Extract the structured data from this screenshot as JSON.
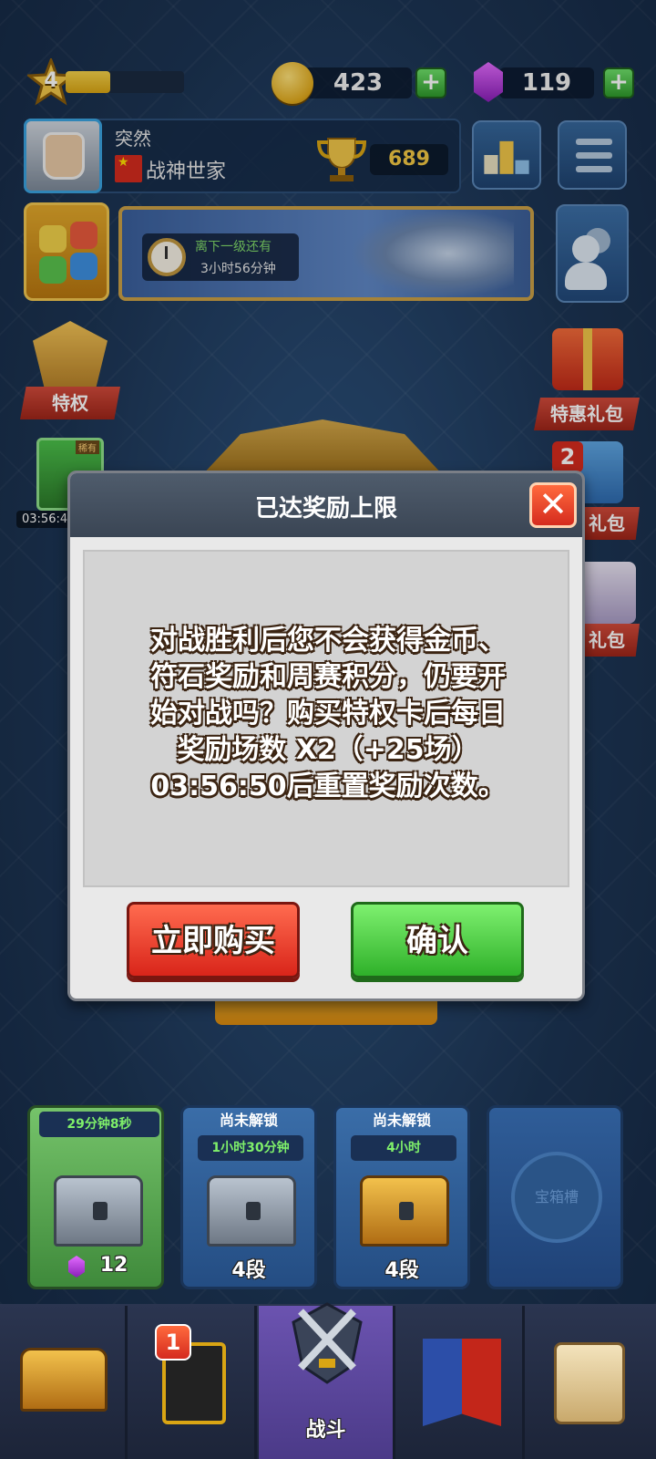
{
  "topbar": {
    "level": "4",
    "xp_fraction": 0.38,
    "coins": "423",
    "gems": "119"
  },
  "player": {
    "name": "突然",
    "clan": "战神世家",
    "trophies": "689"
  },
  "levelup_timer": {
    "label": "离下一级还有",
    "value": "3小时56分钟"
  },
  "side": {
    "privilege_label": "特权",
    "special_pack_label": "特惠礼包",
    "pack2_label": "礼包",
    "pack2_badge": "2",
    "pack3_label": "礼包",
    "hero_card_tag": "稀有",
    "hero_time": "03:56:4"
  },
  "dialog": {
    "title": "已达奖励上限",
    "message_lines": [
      "对战胜利后您不会获得金币、",
      "符石奖励和周赛积分，仍要开",
      "始对战吗？购买特权卡后每日",
      "奖励场数 X2（+25场）",
      "03:56:50后重置奖励次数。"
    ],
    "buy_label": "立即购买",
    "confirm_label": "确认",
    "close_glyph": "✕"
  },
  "chests": [
    {
      "header": "29分钟8秒",
      "status": "unlocking",
      "footer": "12",
      "type": "silver"
    },
    {
      "header": "尚未解锁",
      "timer": "1小时30分钟",
      "footer": "4段",
      "type": "silver"
    },
    {
      "header": "尚未解锁",
      "timer": "4小时",
      "footer": "4段",
      "type": "gold"
    },
    {
      "header": "",
      "empty_label": "宝箱槽",
      "type": "empty"
    }
  ],
  "nav": {
    "items": [
      {
        "icon": "shop-chest-icon"
      },
      {
        "icon": "cards-icon",
        "badge": "1"
      },
      {
        "icon": "battle-swords-icon",
        "label": "战斗"
      },
      {
        "icon": "clan-banner-icon"
      },
      {
        "icon": "quest-scroll-icon"
      }
    ]
  },
  "colors": {
    "accent_green": "#2fb12a",
    "accent_red": "#d9251a",
    "gold": "#f2c744"
  }
}
